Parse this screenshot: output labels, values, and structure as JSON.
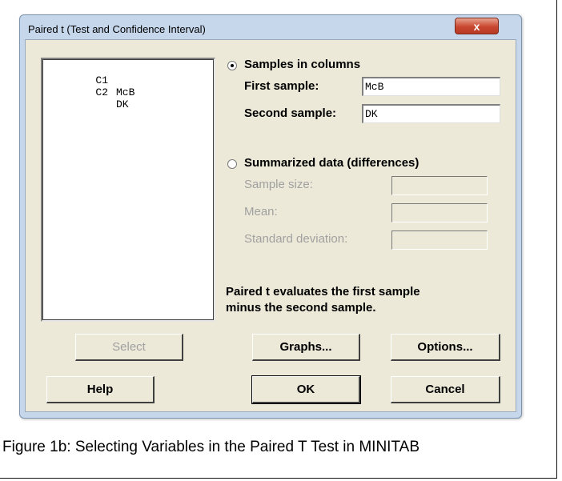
{
  "dialog": {
    "title": "Paired t (Test and Confidence Interval)",
    "close_glyph": "x"
  },
  "variables": [
    {
      "col": "C1",
      "name": "McB"
    },
    {
      "col": "C2",
      "name": "DK"
    }
  ],
  "samples_in_columns": {
    "label": "Samples in columns",
    "selected": true,
    "first_sample_label": "First sample:",
    "first_sample_value": "McB",
    "second_sample_label": "Second sample:",
    "second_sample_value": "DK"
  },
  "summarized": {
    "label": "Summarized data (differences)",
    "selected": false,
    "sample_size_label": "Sample size:",
    "mean_label": "Mean:",
    "stdev_label": "Standard deviation:"
  },
  "note": {
    "line1": "Paired t evaluates the first sample",
    "line2": "minus the second sample."
  },
  "buttons": {
    "select": "Select",
    "graphs": "Graphs...",
    "options": "Options...",
    "help": "Help",
    "ok": "OK",
    "cancel": "Cancel"
  },
  "caption": "Figure 1b: Selecting Variables in the Paired T Test in MINITAB"
}
